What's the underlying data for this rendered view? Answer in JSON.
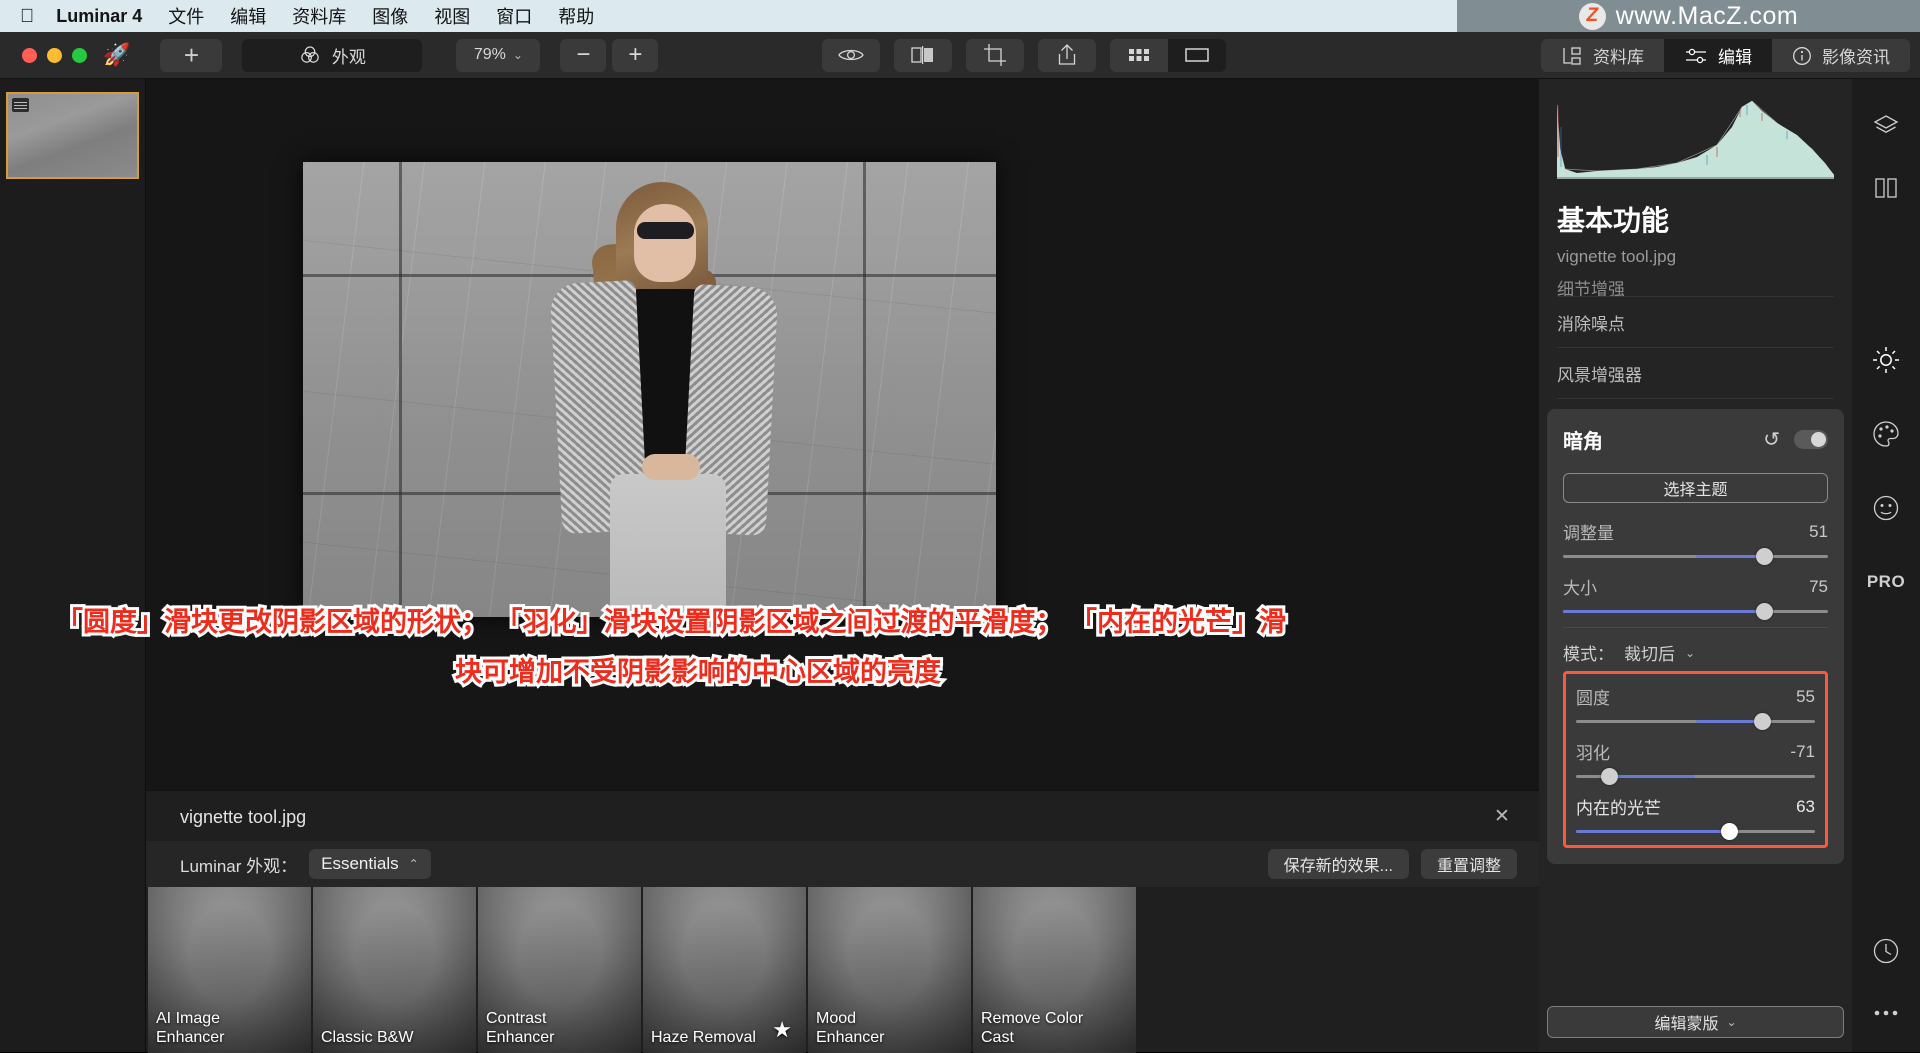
{
  "menubar": {
    "apple_icon": "apple-logo",
    "app_name": "Luminar 4",
    "items": [
      "文件",
      "编辑",
      "资料库",
      "图像",
      "视图",
      "窗口",
      "帮助"
    ],
    "watermark_badge": "Z",
    "watermark_text": "www.MacZ.com"
  },
  "toolbar": {
    "add_label": "+",
    "looks_label": "外观",
    "zoom_value": "79%",
    "zoom_caret": "⌄",
    "minus_label": "−",
    "plus_label": "+",
    "icons": [
      "eye-icon",
      "compare-icon",
      "crop-icon",
      "share-icon",
      "grid-icon",
      "single-view-icon"
    ],
    "tabs": [
      {
        "label": "资料库",
        "icon": "library-icon",
        "active": false
      },
      {
        "label": "编辑",
        "icon": "edit-sliders-icon",
        "active": true
      },
      {
        "label": "影像资讯",
        "icon": "info-icon",
        "active": false
      }
    ]
  },
  "right_panel": {
    "title": "基本功能",
    "filename": "vignette tool.jpg",
    "tools": [
      "细节增强",
      "消除噪点",
      "风景增强器"
    ],
    "vignette": {
      "title": "暗角",
      "undo_icon": "undo-icon",
      "toggle_state": "on",
      "select_subject_label": "选择主题",
      "sliders": [
        {
          "label": "调整量",
          "value": "51",
          "pct": 76
        },
        {
          "label": "大小",
          "value": "75",
          "pct": 76
        }
      ],
      "mode_label": "模式：",
      "mode_value": "裁切后",
      "mode_caret": "⌄",
      "highlighted_sliders": [
        {
          "label": "圆度",
          "value": "55",
          "pct": 78
        },
        {
          "label": "羽化",
          "value": "-71",
          "pct": 14
        },
        {
          "label": "内在的光芒",
          "value": "63",
          "pct": 64
        }
      ],
      "highlight_color": "#fb5842"
    },
    "edit_mask_label": "编辑蒙版",
    "edit_mask_caret": "⌄"
  },
  "tool_rail": {
    "icons": [
      "layers-icon",
      "compare-split-icon",
      "light-sun-icon",
      "color-palette-icon",
      "portrait-face-icon",
      "pro-icon",
      "history-clock-icon",
      "more-dots-icon"
    ],
    "pro_label": "PRO"
  },
  "presets": {
    "filename": "vignette tool.jpg",
    "close_icon": "close-icon",
    "looks_label": "Luminar 外观：",
    "collection": "Essentials",
    "collection_caret": "⌃",
    "save_label": "保存新的效果...",
    "reset_label": "重置调整",
    "items": [
      {
        "label": "AI Image\nEnhancer",
        "starred": false
      },
      {
        "label": "Classic B&W",
        "starred": false
      },
      {
        "label": "Contrast\nEnhancer",
        "starred": false
      },
      {
        "label": "Haze Removal",
        "starred": true
      },
      {
        "label": "Mood\nEnhancer",
        "starred": false
      },
      {
        "label": "Remove Color\nCast",
        "starred": false
      }
    ]
  },
  "annotation": {
    "line1": "「圆度」滑块更改阴影区域的形状； 「羽化」滑块设置阴影区域之间过渡的平滑度； 「内在的光芒」滑",
    "line2": "块可增加不受阴影影响的中心区域的亮度",
    "color": "#ef2b1c"
  }
}
